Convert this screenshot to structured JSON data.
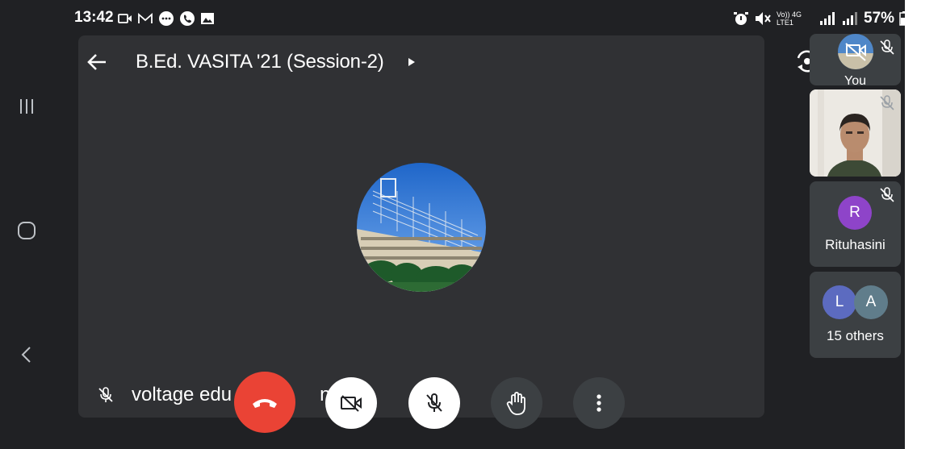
{
  "status_bar": {
    "time": "13:42",
    "left_icons": [
      "video-record-icon",
      "mail-icon",
      "message-icon",
      "phone-icon",
      "image-icon"
    ],
    "right_icons": [
      "alarm-icon",
      "mute-icon",
      "volte-icon",
      "data-4g-icon",
      "signal-icon",
      "signal-icon-2"
    ],
    "network_small": "Vo)) 4G LTE1",
    "battery": "57%"
  },
  "meeting": {
    "title": "B.Ed. VASITA '21 (Session-2)",
    "presenter_name": "voltage edu",
    "presenter_name_tail": "n"
  },
  "participants": {
    "you_label": "You",
    "third_name": "Rituhasini",
    "third_initial": "R",
    "group_initials": [
      "L",
      "A"
    ],
    "others_label": "15 others"
  },
  "colors": {
    "background": "#202124",
    "stage": "#303134",
    "tile": "#3c4043",
    "end_call": "#ea4335",
    "avatar_r": "#8e44c9",
    "avatar_l": "#5c6bc0",
    "avatar_a": "#607d8b"
  }
}
